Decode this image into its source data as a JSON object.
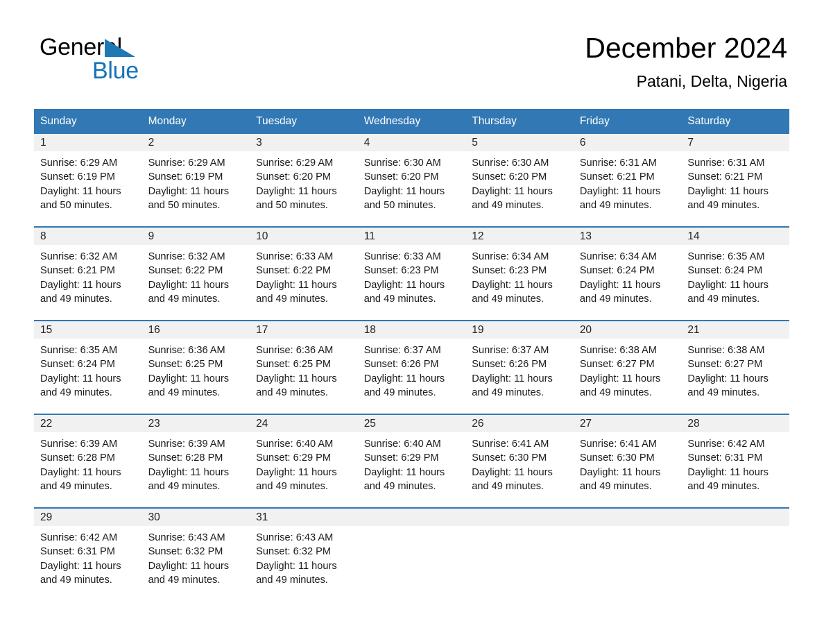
{
  "brand": {
    "word_one": "General",
    "word_two": "Blue",
    "triangle_color": "#1f77b4",
    "blue_color": "#1572b8"
  },
  "header": {
    "month_title": "December 2024",
    "location": "Patani, Delta, Nigeria"
  },
  "theme": {
    "header_blue": "#3178b4",
    "daynum_band": "#f1f1f1",
    "separator_blue": "#3178b4",
    "text": "#1a1a1a"
  },
  "weekday_headers": [
    "Sunday",
    "Monday",
    "Tuesday",
    "Wednesday",
    "Thursday",
    "Friday",
    "Saturday"
  ],
  "weeks": [
    {
      "days": [
        {
          "day": "1",
          "sunrise": "Sunrise: 6:29 AM",
          "sunset": "Sunset: 6:19 PM",
          "daylight_line1": "Daylight: 11 hours",
          "daylight_line2": "and 50 minutes."
        },
        {
          "day": "2",
          "sunrise": "Sunrise: 6:29 AM",
          "sunset": "Sunset: 6:19 PM",
          "daylight_line1": "Daylight: 11 hours",
          "daylight_line2": "and 50 minutes."
        },
        {
          "day": "3",
          "sunrise": "Sunrise: 6:29 AM",
          "sunset": "Sunset: 6:20 PM",
          "daylight_line1": "Daylight: 11 hours",
          "daylight_line2": "and 50 minutes."
        },
        {
          "day": "4",
          "sunrise": "Sunrise: 6:30 AM",
          "sunset": "Sunset: 6:20 PM",
          "daylight_line1": "Daylight: 11 hours",
          "daylight_line2": "and 50 minutes."
        },
        {
          "day": "5",
          "sunrise": "Sunrise: 6:30 AM",
          "sunset": "Sunset: 6:20 PM",
          "daylight_line1": "Daylight: 11 hours",
          "daylight_line2": "and 49 minutes."
        },
        {
          "day": "6",
          "sunrise": "Sunrise: 6:31 AM",
          "sunset": "Sunset: 6:21 PM",
          "daylight_line1": "Daylight: 11 hours",
          "daylight_line2": "and 49 minutes."
        },
        {
          "day": "7",
          "sunrise": "Sunrise: 6:31 AM",
          "sunset": "Sunset: 6:21 PM",
          "daylight_line1": "Daylight: 11 hours",
          "daylight_line2": "and 49 minutes."
        }
      ]
    },
    {
      "days": [
        {
          "day": "8",
          "sunrise": "Sunrise: 6:32 AM",
          "sunset": "Sunset: 6:21 PM",
          "daylight_line1": "Daylight: 11 hours",
          "daylight_line2": "and 49 minutes."
        },
        {
          "day": "9",
          "sunrise": "Sunrise: 6:32 AM",
          "sunset": "Sunset: 6:22 PM",
          "daylight_line1": "Daylight: 11 hours",
          "daylight_line2": "and 49 minutes."
        },
        {
          "day": "10",
          "sunrise": "Sunrise: 6:33 AM",
          "sunset": "Sunset: 6:22 PM",
          "daylight_line1": "Daylight: 11 hours",
          "daylight_line2": "and 49 minutes."
        },
        {
          "day": "11",
          "sunrise": "Sunrise: 6:33 AM",
          "sunset": "Sunset: 6:23 PM",
          "daylight_line1": "Daylight: 11 hours",
          "daylight_line2": "and 49 minutes."
        },
        {
          "day": "12",
          "sunrise": "Sunrise: 6:34 AM",
          "sunset": "Sunset: 6:23 PM",
          "daylight_line1": "Daylight: 11 hours",
          "daylight_line2": "and 49 minutes."
        },
        {
          "day": "13",
          "sunrise": "Sunrise: 6:34 AM",
          "sunset": "Sunset: 6:24 PM",
          "daylight_line1": "Daylight: 11 hours",
          "daylight_line2": "and 49 minutes."
        },
        {
          "day": "14",
          "sunrise": "Sunrise: 6:35 AM",
          "sunset": "Sunset: 6:24 PM",
          "daylight_line1": "Daylight: 11 hours",
          "daylight_line2": "and 49 minutes."
        }
      ]
    },
    {
      "days": [
        {
          "day": "15",
          "sunrise": "Sunrise: 6:35 AM",
          "sunset": "Sunset: 6:24 PM",
          "daylight_line1": "Daylight: 11 hours",
          "daylight_line2": "and 49 minutes."
        },
        {
          "day": "16",
          "sunrise": "Sunrise: 6:36 AM",
          "sunset": "Sunset: 6:25 PM",
          "daylight_line1": "Daylight: 11 hours",
          "daylight_line2": "and 49 minutes."
        },
        {
          "day": "17",
          "sunrise": "Sunrise: 6:36 AM",
          "sunset": "Sunset: 6:25 PM",
          "daylight_line1": "Daylight: 11 hours",
          "daylight_line2": "and 49 minutes."
        },
        {
          "day": "18",
          "sunrise": "Sunrise: 6:37 AM",
          "sunset": "Sunset: 6:26 PM",
          "daylight_line1": "Daylight: 11 hours",
          "daylight_line2": "and 49 minutes."
        },
        {
          "day": "19",
          "sunrise": "Sunrise: 6:37 AM",
          "sunset": "Sunset: 6:26 PM",
          "daylight_line1": "Daylight: 11 hours",
          "daylight_line2": "and 49 minutes."
        },
        {
          "day": "20",
          "sunrise": "Sunrise: 6:38 AM",
          "sunset": "Sunset: 6:27 PM",
          "daylight_line1": "Daylight: 11 hours",
          "daylight_line2": "and 49 minutes."
        },
        {
          "day": "21",
          "sunrise": "Sunrise: 6:38 AM",
          "sunset": "Sunset: 6:27 PM",
          "daylight_line1": "Daylight: 11 hours",
          "daylight_line2": "and 49 minutes."
        }
      ]
    },
    {
      "days": [
        {
          "day": "22",
          "sunrise": "Sunrise: 6:39 AM",
          "sunset": "Sunset: 6:28 PM",
          "daylight_line1": "Daylight: 11 hours",
          "daylight_line2": "and 49 minutes."
        },
        {
          "day": "23",
          "sunrise": "Sunrise: 6:39 AM",
          "sunset": "Sunset: 6:28 PM",
          "daylight_line1": "Daylight: 11 hours",
          "daylight_line2": "and 49 minutes."
        },
        {
          "day": "24",
          "sunrise": "Sunrise: 6:40 AM",
          "sunset": "Sunset: 6:29 PM",
          "daylight_line1": "Daylight: 11 hours",
          "daylight_line2": "and 49 minutes."
        },
        {
          "day": "25",
          "sunrise": "Sunrise: 6:40 AM",
          "sunset": "Sunset: 6:29 PM",
          "daylight_line1": "Daylight: 11 hours",
          "daylight_line2": "and 49 minutes."
        },
        {
          "day": "26",
          "sunrise": "Sunrise: 6:41 AM",
          "sunset": "Sunset: 6:30 PM",
          "daylight_line1": "Daylight: 11 hours",
          "daylight_line2": "and 49 minutes."
        },
        {
          "day": "27",
          "sunrise": "Sunrise: 6:41 AM",
          "sunset": "Sunset: 6:30 PM",
          "daylight_line1": "Daylight: 11 hours",
          "daylight_line2": "and 49 minutes."
        },
        {
          "day": "28",
          "sunrise": "Sunrise: 6:42 AM",
          "sunset": "Sunset: 6:31 PM",
          "daylight_line1": "Daylight: 11 hours",
          "daylight_line2": "and 49 minutes."
        }
      ]
    },
    {
      "days": [
        {
          "day": "29",
          "sunrise": "Sunrise: 6:42 AM",
          "sunset": "Sunset: 6:31 PM",
          "daylight_line1": "Daylight: 11 hours",
          "daylight_line2": "and 49 minutes."
        },
        {
          "day": "30",
          "sunrise": "Sunrise: 6:43 AM",
          "sunset": "Sunset: 6:32 PM",
          "daylight_line1": "Daylight: 11 hours",
          "daylight_line2": "and 49 minutes."
        },
        {
          "day": "31",
          "sunrise": "Sunrise: 6:43 AM",
          "sunset": "Sunset: 6:32 PM",
          "daylight_line1": "Daylight: 11 hours",
          "daylight_line2": "and 49 minutes."
        },
        {
          "day": "",
          "sunrise": "",
          "sunset": "",
          "daylight_line1": "",
          "daylight_line2": ""
        },
        {
          "day": "",
          "sunrise": "",
          "sunset": "",
          "daylight_line1": "",
          "daylight_line2": ""
        },
        {
          "day": "",
          "sunrise": "",
          "sunset": "",
          "daylight_line1": "",
          "daylight_line2": ""
        },
        {
          "day": "",
          "sunrise": "",
          "sunset": "",
          "daylight_line1": "",
          "daylight_line2": ""
        }
      ]
    }
  ]
}
